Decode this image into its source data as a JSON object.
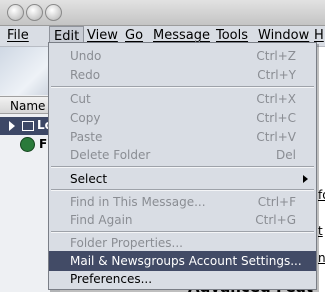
{
  "menubar": {
    "items": [
      {
        "label": "File"
      },
      {
        "label": "Edit"
      },
      {
        "label": "View"
      },
      {
        "label": "Go"
      },
      {
        "label": "Message"
      },
      {
        "label": "Tools"
      },
      {
        "label": "Window"
      },
      {
        "label": "H"
      }
    ]
  },
  "sidebar": {
    "column_header": "Name",
    "tree": [
      {
        "label": "Lo"
      },
      {
        "label": "Fi"
      }
    ]
  },
  "edit_menu": {
    "items": [
      {
        "label": "Undo",
        "shortcut": "Ctrl+Z",
        "enabled": false
      },
      {
        "label": "Redo",
        "shortcut": "Ctrl+Y",
        "enabled": false
      },
      {
        "label": "Cut",
        "shortcut": "Ctrl+X",
        "enabled": false
      },
      {
        "label": "Copy",
        "shortcut": "Ctrl+C",
        "enabled": false
      },
      {
        "label": "Paste",
        "shortcut": "Ctrl+V",
        "enabled": false
      },
      {
        "label": "Delete Folder",
        "shortcut": "Del",
        "enabled": false
      },
      {
        "label": "Select",
        "shortcut": "",
        "enabled": true
      },
      {
        "label": "Find in This Message...",
        "shortcut": "Ctrl+F",
        "enabled": false
      },
      {
        "label": "Find Again",
        "shortcut": "Ctrl+G",
        "enabled": false
      },
      {
        "label": "Folder Properties...",
        "shortcut": "",
        "enabled": false
      },
      {
        "label": "Mail & Newsgroups Account Settings...",
        "shortcut": "",
        "enabled": true
      },
      {
        "label": "Preferences...",
        "shortcut": "",
        "enabled": true
      }
    ]
  },
  "background": {
    "fragment1": "fo",
    "fragment2": "t",
    "fragment3": "nu",
    "heading_fragment": "Advanced Feat"
  }
}
